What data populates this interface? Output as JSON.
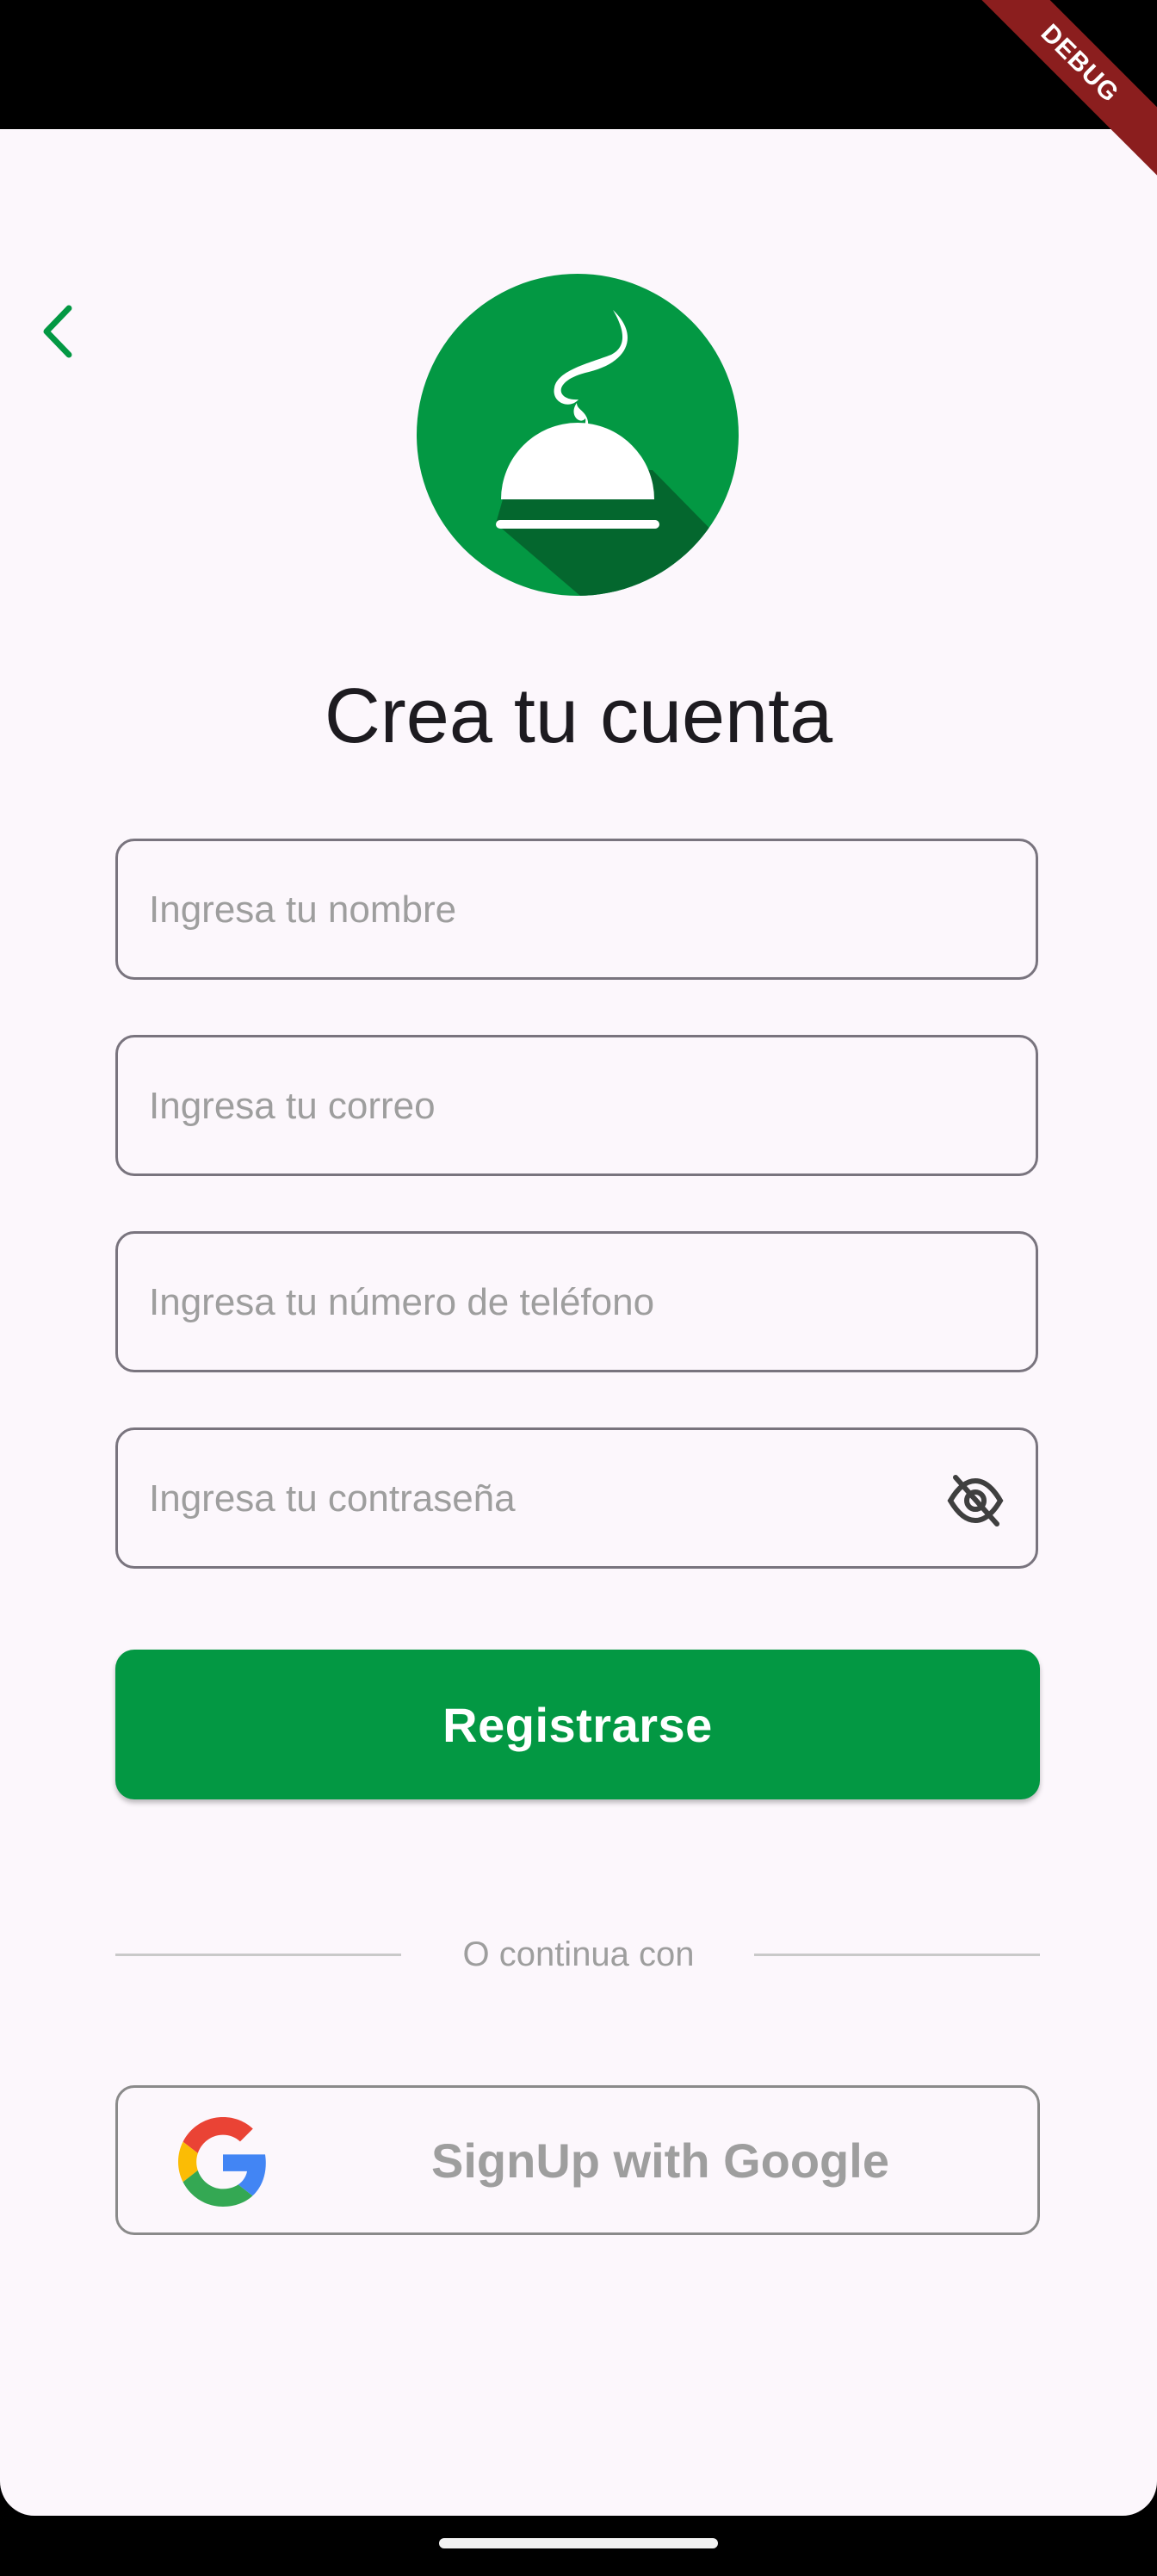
{
  "system": {
    "debug_banner": "DEBUG"
  },
  "header": {
    "back_icon": "chevron-left-icon"
  },
  "logo": {
    "icon": "service-bell-icon",
    "color": "#039843"
  },
  "page_title": "Crea tu cuenta",
  "form": {
    "name": {
      "placeholder": "Ingresa tu nombre",
      "value": ""
    },
    "email": {
      "placeholder": "Ingresa tu correo",
      "value": ""
    },
    "phone": {
      "placeholder": "Ingresa tu número de teléfono",
      "value": ""
    },
    "password": {
      "placeholder": "Ingresa tu contraseña",
      "value": "",
      "toggle_icon": "eye-off-icon"
    }
  },
  "register_button": {
    "label": "Registrarse",
    "color": "#039843"
  },
  "divider": {
    "text": "O continua con"
  },
  "google_button": {
    "label": "SignUp with Google",
    "icon": "google-logo-icon"
  }
}
